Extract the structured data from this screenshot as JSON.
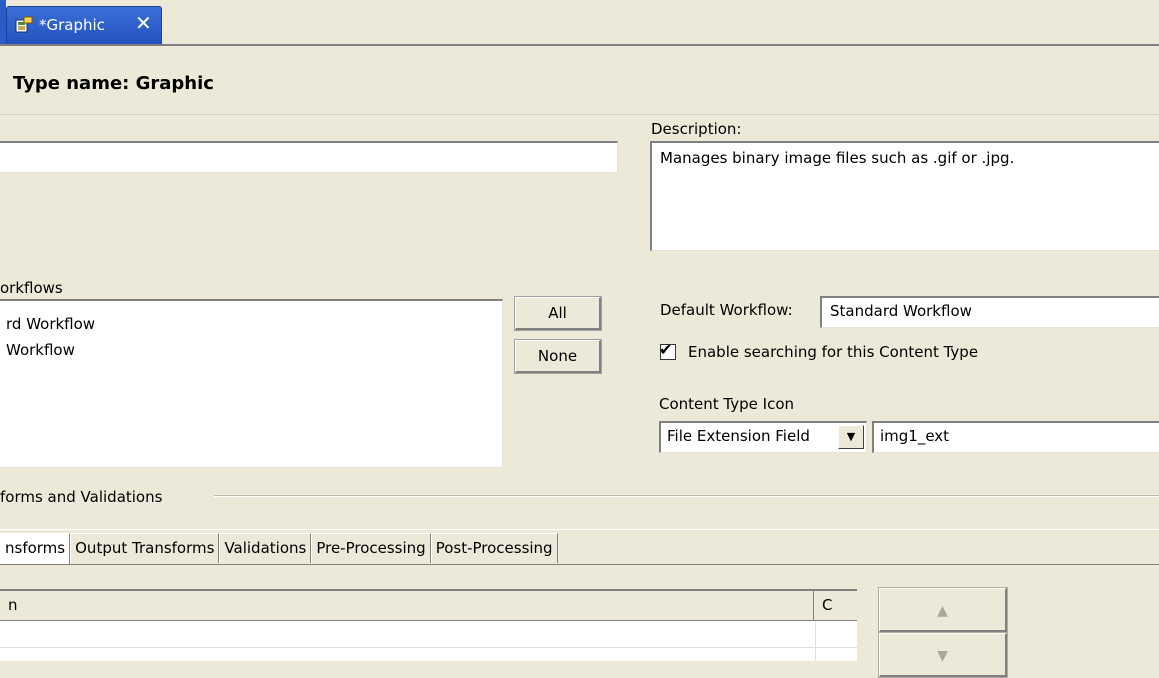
{
  "editor_tab": {
    "title": "*Graphic",
    "close_glyph": "✕",
    "icon": "content-type-icon"
  },
  "header": {
    "title": "Type name: Graphic"
  },
  "name_field": {
    "value": ""
  },
  "description": {
    "label": "Description:",
    "value": "Manages binary image files such as .gif or .jpg."
  },
  "workflows": {
    "label": "orkflows",
    "items": [
      "rd Workflow",
      "Workflow"
    ],
    "all_button": "All",
    "none_button": "None"
  },
  "default_workflow": {
    "label": "Default Workflow:",
    "value": "Standard Workflow"
  },
  "enable_search": {
    "checked": true,
    "label": "Enable searching for this Content Type"
  },
  "content_type_icon": {
    "label": "Content Type Icon",
    "select_value": "File Extension Field",
    "field_value": "img1_ext"
  },
  "transforms_group": {
    "label": "forms and Validations",
    "tabs": [
      "nsforms",
      "Output Transforms",
      "Validations",
      "Pre-Processing",
      "Post-Processing"
    ],
    "active_tab": 0
  },
  "table": {
    "columns": [
      "n",
      "C"
    ]
  },
  "order_buttons": {
    "up": "▲",
    "down": "▼"
  },
  "colors": {
    "tab_active": "#2a5bc6",
    "background": "#ece9d8"
  }
}
